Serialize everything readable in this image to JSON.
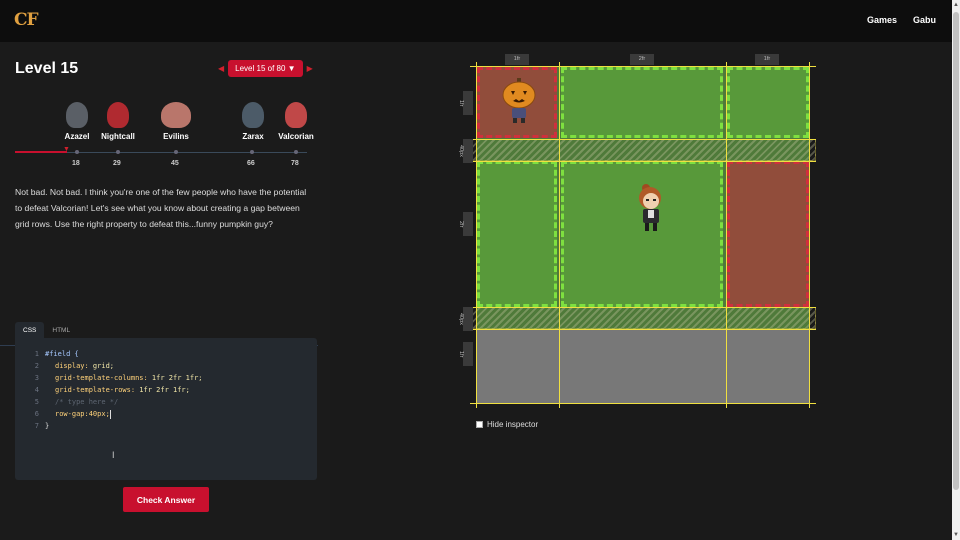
{
  "header": {
    "logo": "CF",
    "nav": [
      "Games",
      "Gabu"
    ]
  },
  "level": {
    "title": "Level 15",
    "selector": "Level 15 of 80 ▼",
    "prev_arrow": "◀",
    "next_arrow": "▶"
  },
  "bosses": [
    {
      "name": "Azazel",
      "level": "18",
      "color": "#5a5f66"
    },
    {
      "name": "Nightcall",
      "level": "29",
      "color": "#b02a30"
    },
    {
      "name": "Evilins",
      "level": "45",
      "color": "#b9766b"
    },
    {
      "name": "Zarax",
      "level": "66",
      "color": "#4c5b68"
    },
    {
      "name": "Valcorian",
      "level": "78",
      "color": "#c04848"
    }
  ],
  "progress": {
    "current_level": 15,
    "max_level": 80
  },
  "story": "Not bad. Not bad. I think you're one of the few people who have the potential to defeat Valcorian! Let's see what you know about creating a gap between grid rows. Use the right property to defeat this...funny pumpkin guy?",
  "editor": {
    "tabs": [
      "CSS",
      "HTML"
    ],
    "active_tab": "CSS",
    "lines": [
      {
        "n": "1",
        "sel": "#field {"
      },
      {
        "n": "2",
        "prop": "display:",
        "val": " grid;"
      },
      {
        "n": "3",
        "prop": "grid-template-columns:",
        "val": " 1fr 2fr 1fr;"
      },
      {
        "n": "4",
        "prop": "grid-template-rows:",
        "val": " 1fr 2fr 1fr;"
      },
      {
        "n": "5",
        "comment": "/* type here */"
      },
      {
        "n": "6",
        "input": "row-gap:40px;"
      },
      {
        "n": "7",
        "close": "}"
      }
    ],
    "check_button": "Check Answer"
  },
  "board": {
    "col_labels": [
      "1fr",
      "2fr",
      "1fr"
    ],
    "row_labels": [
      "1fr",
      "40px",
      "2fr",
      "40px",
      "1fr"
    ],
    "hide_inspector": "Hide inspector"
  },
  "colors": {
    "accent": "#c8102e",
    "grid_line": "#f0e040",
    "target_red": "#d02f3d",
    "target_green": "#7ee040"
  }
}
